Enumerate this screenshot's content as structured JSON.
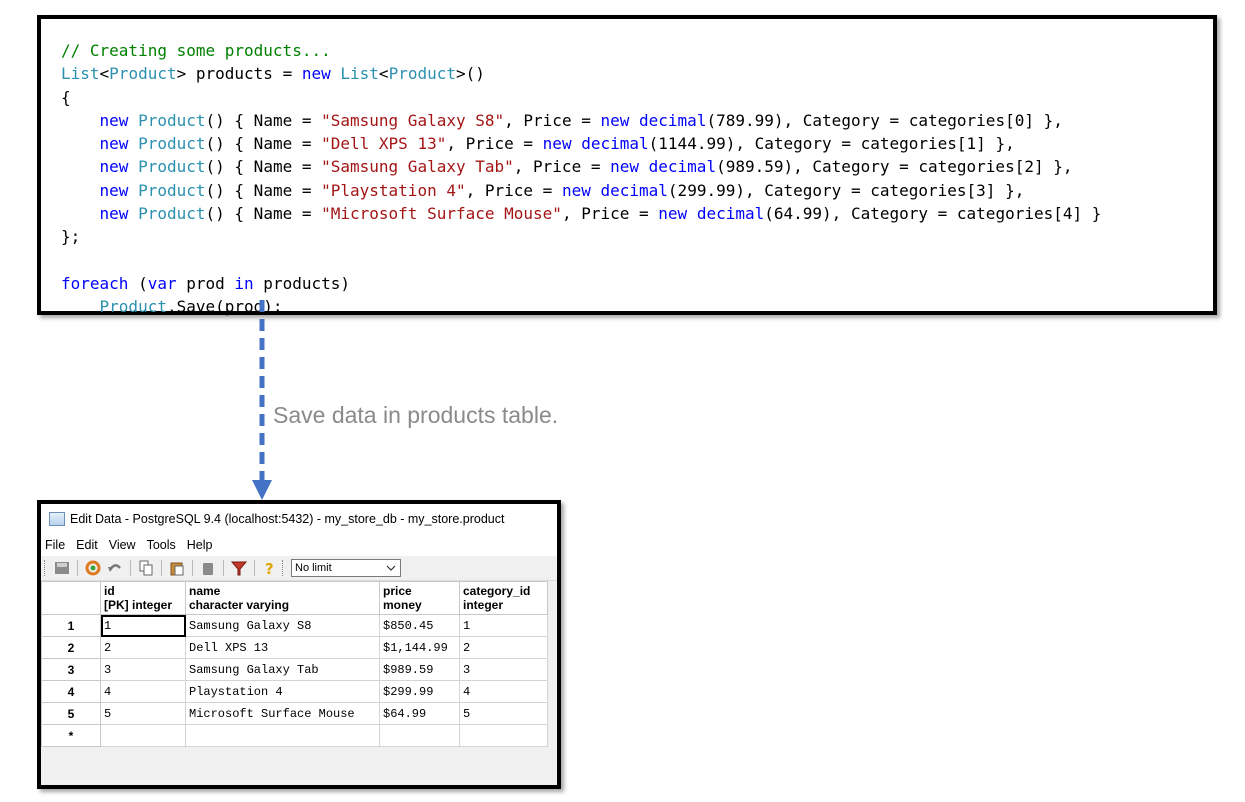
{
  "code": {
    "lines": [
      [
        {
          "t": "// Creating some products...",
          "c": "comment"
        }
      ],
      [
        {
          "t": "List",
          "c": "type"
        },
        {
          "t": "<",
          "c": "plain"
        },
        {
          "t": "Product",
          "c": "type"
        },
        {
          "t": "> products = ",
          "c": "plain"
        },
        {
          "t": "new",
          "c": "kw"
        },
        {
          "t": " ",
          "c": "plain"
        },
        {
          "t": "List",
          "c": "type"
        },
        {
          "t": "<",
          "c": "plain"
        },
        {
          "t": "Product",
          "c": "type"
        },
        {
          "t": ">()",
          "c": "plain"
        }
      ],
      [
        {
          "t": "{",
          "c": "plain"
        }
      ],
      [
        {
          "t": "    ",
          "c": "plain"
        },
        {
          "t": "new",
          "c": "kw"
        },
        {
          "t": " ",
          "c": "plain"
        },
        {
          "t": "Product",
          "c": "type"
        },
        {
          "t": "() { Name = ",
          "c": "plain"
        },
        {
          "t": "\"Samsung Galaxy S8\"",
          "c": "str"
        },
        {
          "t": ", Price = ",
          "c": "plain"
        },
        {
          "t": "new",
          "c": "kw"
        },
        {
          "t": " ",
          "c": "plain"
        },
        {
          "t": "decimal",
          "c": "kw"
        },
        {
          "t": "(789.99), Category = categories[0] },",
          "c": "plain"
        }
      ],
      [
        {
          "t": "    ",
          "c": "plain"
        },
        {
          "t": "new",
          "c": "kw"
        },
        {
          "t": " ",
          "c": "plain"
        },
        {
          "t": "Product",
          "c": "type"
        },
        {
          "t": "() { Name = ",
          "c": "plain"
        },
        {
          "t": "\"Dell XPS 13\"",
          "c": "str"
        },
        {
          "t": ", Price = ",
          "c": "plain"
        },
        {
          "t": "new",
          "c": "kw"
        },
        {
          "t": " ",
          "c": "plain"
        },
        {
          "t": "decimal",
          "c": "kw"
        },
        {
          "t": "(1144.99), Category = categories[1] },",
          "c": "plain"
        }
      ],
      [
        {
          "t": "    ",
          "c": "plain"
        },
        {
          "t": "new",
          "c": "kw"
        },
        {
          "t": " ",
          "c": "plain"
        },
        {
          "t": "Product",
          "c": "type"
        },
        {
          "t": "() { Name = ",
          "c": "plain"
        },
        {
          "t": "\"Samsung Galaxy Tab\"",
          "c": "str"
        },
        {
          "t": ", Price = ",
          "c": "plain"
        },
        {
          "t": "new",
          "c": "kw"
        },
        {
          "t": " ",
          "c": "plain"
        },
        {
          "t": "decimal",
          "c": "kw"
        },
        {
          "t": "(989.59), Category = categories[2] },",
          "c": "plain"
        }
      ],
      [
        {
          "t": "    ",
          "c": "plain"
        },
        {
          "t": "new",
          "c": "kw"
        },
        {
          "t": " ",
          "c": "plain"
        },
        {
          "t": "Product",
          "c": "type"
        },
        {
          "t": "() { Name = ",
          "c": "plain"
        },
        {
          "t": "\"Playstation 4\"",
          "c": "str"
        },
        {
          "t": ", Price = ",
          "c": "plain"
        },
        {
          "t": "new",
          "c": "kw"
        },
        {
          "t": " ",
          "c": "plain"
        },
        {
          "t": "decimal",
          "c": "kw"
        },
        {
          "t": "(299.99), Category = categories[3] },",
          "c": "plain"
        }
      ],
      [
        {
          "t": "    ",
          "c": "plain"
        },
        {
          "t": "new",
          "c": "kw"
        },
        {
          "t": " ",
          "c": "plain"
        },
        {
          "t": "Product",
          "c": "type"
        },
        {
          "t": "() { Name = ",
          "c": "plain"
        },
        {
          "t": "\"Microsoft Surface Mouse\"",
          "c": "str"
        },
        {
          "t": ", Price = ",
          "c": "plain"
        },
        {
          "t": "new",
          "c": "kw"
        },
        {
          "t": " ",
          "c": "plain"
        },
        {
          "t": "decimal",
          "c": "kw"
        },
        {
          "t": "(64.99), Category = categories[4] }",
          "c": "plain"
        }
      ],
      [
        {
          "t": "};",
          "c": "plain"
        }
      ],
      [
        {
          "t": "",
          "c": "plain"
        }
      ],
      [
        {
          "t": "foreach",
          "c": "kw"
        },
        {
          "t": " (",
          "c": "plain"
        },
        {
          "t": "var",
          "c": "kw"
        },
        {
          "t": " prod ",
          "c": "plain"
        },
        {
          "t": "in",
          "c": "kw"
        },
        {
          "t": " products)",
          "c": "plain"
        }
      ],
      [
        {
          "t": "    ",
          "c": "plain"
        },
        {
          "t": "Product",
          "c": "type"
        },
        {
          "t": ".Save(prod);",
          "c": "plain"
        }
      ]
    ]
  },
  "arrow": {
    "caption": "Save data in products table.",
    "color": "#4472c4"
  },
  "editor": {
    "title": "Edit Data - PostgreSQL 9.4 (localhost:5432) - my_store_db - my_store.product",
    "menu": [
      "File",
      "Edit",
      "View",
      "Tools",
      "Help"
    ],
    "toolbar_icons": [
      "save-icon",
      "refresh-icon",
      "undo-icon",
      "copy-icon",
      "paste-icon",
      "delete-icon",
      "filter-icon",
      "help-icon"
    ],
    "limit": {
      "selected": "No limit"
    },
    "columns": [
      {
        "name": "id",
        "type": "[PK] integer"
      },
      {
        "name": "name",
        "type": "character varying"
      },
      {
        "name": "price",
        "type": "money"
      },
      {
        "name": "category_id",
        "type": "integer"
      }
    ],
    "rows": [
      {
        "num": "1",
        "id": "1",
        "name": "Samsung Galaxy S8",
        "price": "$850.45",
        "category_id": "1"
      },
      {
        "num": "2",
        "id": "2",
        "name": "Dell XPS 13",
        "price": "$1,144.99",
        "category_id": "2"
      },
      {
        "num": "3",
        "id": "3",
        "name": "Samsung Galaxy Tab",
        "price": "$989.59",
        "category_id": "3"
      },
      {
        "num": "4",
        "id": "4",
        "name": "Playstation 4",
        "price": "$299.99",
        "category_id": "4"
      },
      {
        "num": "5",
        "id": "5",
        "name": "Microsoft Surface Mouse",
        "price": "$64.99",
        "category_id": "5"
      }
    ],
    "new_row_marker": "*"
  }
}
